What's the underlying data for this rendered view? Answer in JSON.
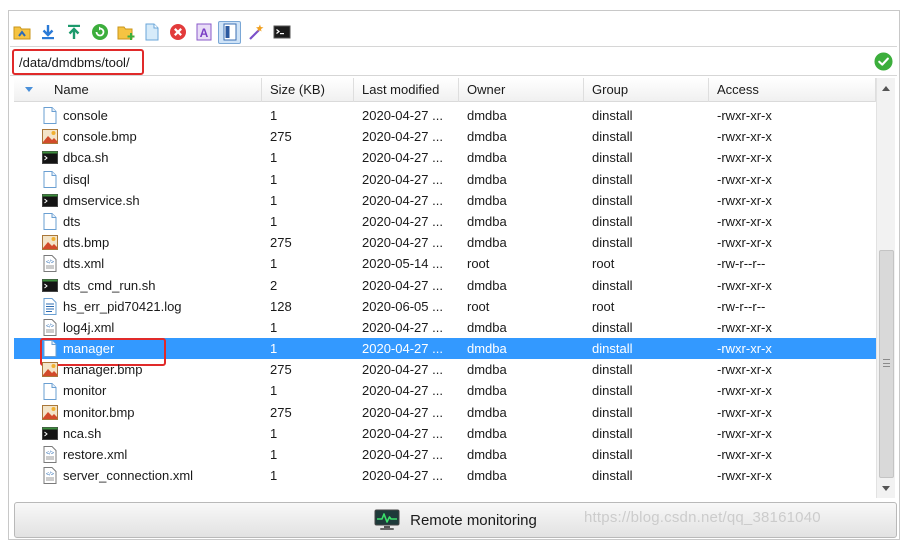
{
  "toolbar": {
    "buttons": [
      {
        "name": "parent-folder-icon"
      },
      {
        "name": "download-icon"
      },
      {
        "name": "upload-icon"
      },
      {
        "name": "refresh-icon"
      },
      {
        "name": "new-folder-icon"
      },
      {
        "name": "new-file-icon"
      },
      {
        "name": "delete-icon"
      },
      {
        "name": "rename-icon"
      },
      {
        "name": "toggle-panel-icon",
        "active": true
      },
      {
        "name": "magic-wand-icon"
      },
      {
        "name": "terminal-icon"
      }
    ]
  },
  "path": {
    "value": "/data/dmdbms/tool/",
    "status_icon": "ok-check-icon"
  },
  "table": {
    "columns": [
      "Name",
      "Size (KB)",
      "Last modified",
      "Owner",
      "Group",
      "Access"
    ],
    "rows": [
      {
        "icon": "file",
        "name": "console",
        "size": "1",
        "modified": "2020-04-27 ...",
        "owner": "dmdba",
        "group": "dinstall",
        "access": "-rwxr-xr-x"
      },
      {
        "icon": "bmp",
        "name": "console.bmp",
        "size": "275",
        "modified": "2020-04-27 ...",
        "owner": "dmdba",
        "group": "dinstall",
        "access": "-rwxr-xr-x"
      },
      {
        "icon": "sh",
        "name": "dbca.sh",
        "size": "1",
        "modified": "2020-04-27 ...",
        "owner": "dmdba",
        "group": "dinstall",
        "access": "-rwxr-xr-x"
      },
      {
        "icon": "file",
        "name": "disql",
        "size": "1",
        "modified": "2020-04-27 ...",
        "owner": "dmdba",
        "group": "dinstall",
        "access": "-rwxr-xr-x"
      },
      {
        "icon": "sh",
        "name": "dmservice.sh",
        "size": "1",
        "modified": "2020-04-27 ...",
        "owner": "dmdba",
        "group": "dinstall",
        "access": "-rwxr-xr-x"
      },
      {
        "icon": "file",
        "name": "dts",
        "size": "1",
        "modified": "2020-04-27 ...",
        "owner": "dmdba",
        "group": "dinstall",
        "access": "-rwxr-xr-x"
      },
      {
        "icon": "bmp",
        "name": "dts.bmp",
        "size": "275",
        "modified": "2020-04-27 ...",
        "owner": "dmdba",
        "group": "dinstall",
        "access": "-rwxr-xr-x"
      },
      {
        "icon": "xml",
        "name": "dts.xml",
        "size": "1",
        "modified": "2020-05-14 ...",
        "owner": "root",
        "group": "root",
        "access": "-rw-r--r--"
      },
      {
        "icon": "sh",
        "name": "dts_cmd_run.sh",
        "size": "2",
        "modified": "2020-04-27 ...",
        "owner": "dmdba",
        "group": "dinstall",
        "access": "-rwxr-xr-x"
      },
      {
        "icon": "log",
        "name": "hs_err_pid70421.log",
        "size": "128",
        "modified": "2020-06-05 ...",
        "owner": "root",
        "group": "root",
        "access": "-rw-r--r--"
      },
      {
        "icon": "xml",
        "name": "log4j.xml",
        "size": "1",
        "modified": "2020-04-27 ...",
        "owner": "dmdba",
        "group": "dinstall",
        "access": "-rwxr-xr-x"
      },
      {
        "icon": "file",
        "name": "manager",
        "size": "1",
        "modified": "2020-04-27 ...",
        "owner": "dmdba",
        "group": "dinstall",
        "access": "-rwxr-xr-x",
        "selected": true
      },
      {
        "icon": "bmp",
        "name": "manager.bmp",
        "size": "275",
        "modified": "2020-04-27 ...",
        "owner": "dmdba",
        "group": "dinstall",
        "access": "-rwxr-xr-x"
      },
      {
        "icon": "file",
        "name": "monitor",
        "size": "1",
        "modified": "2020-04-27 ...",
        "owner": "dmdba",
        "group": "dinstall",
        "access": "-rwxr-xr-x"
      },
      {
        "icon": "bmp",
        "name": "monitor.bmp",
        "size": "275",
        "modified": "2020-04-27 ...",
        "owner": "dmdba",
        "group": "dinstall",
        "access": "-rwxr-xr-x"
      },
      {
        "icon": "sh",
        "name": "nca.sh",
        "size": "1",
        "modified": "2020-04-27 ...",
        "owner": "dmdba",
        "group": "dinstall",
        "access": "-rwxr-xr-x"
      },
      {
        "icon": "xml",
        "name": "restore.xml",
        "size": "1",
        "modified": "2020-04-27 ...",
        "owner": "dmdba",
        "group": "dinstall",
        "access": "-rwxr-xr-x"
      },
      {
        "icon": "xml",
        "name": "server_connection.xml",
        "size": "1",
        "modified": "2020-04-27 ...",
        "owner": "dmdba",
        "group": "dinstall",
        "access": "-rwxr-xr-x"
      }
    ]
  },
  "footer": {
    "button_label": "Remote monitoring",
    "button_icon": "monitor-pulse-icon"
  },
  "watermark": "https://blog.csdn.net/qq_38161040",
  "colors": {
    "selection": "#3399ff",
    "highlight_outline": "#e02a2a",
    "ok": "#3cae3c"
  }
}
